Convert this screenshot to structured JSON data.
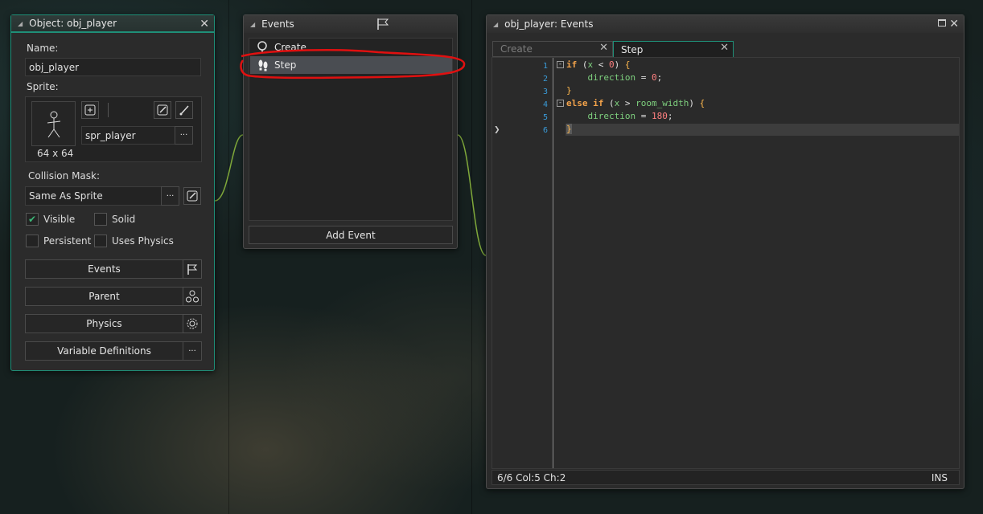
{
  "object_panel": {
    "title": "Object: obj_player",
    "name_label": "Name:",
    "name_value": "obj_player",
    "sprite_label": "Sprite:",
    "sprite_size": "64 x 64",
    "sprite_name": "spr_player",
    "more_glyph": "···",
    "collision_label": "Collision Mask:",
    "collision_value": "Same As Sprite",
    "visible_label": "Visible",
    "solid_label": "Solid",
    "persistent_label": "Persistent",
    "uses_physics_label": "Uses Physics",
    "visible_checked": true,
    "buttons": {
      "events": "Events",
      "parent": "Parent",
      "physics": "Physics",
      "variable_definitions": "Variable Definitions"
    }
  },
  "events_panel": {
    "title": "Events",
    "items": [
      "Create",
      "Step"
    ],
    "selected": "Step",
    "add_event": "Add Event"
  },
  "code_panel": {
    "title": "obj_player: Events",
    "tabs": [
      {
        "label": "Create",
        "active": false
      },
      {
        "label": "Step",
        "active": true
      }
    ],
    "line_numbers": [
      "1",
      "2",
      "3",
      "4",
      "5",
      "6"
    ],
    "code": {
      "l1_kw": "if",
      "l1_a": "(",
      "l1_var": "x",
      "l1_b": " < ",
      "l1_num": "0",
      "l1_c": ") ",
      "l1_br": "{",
      "l2_var": "direction",
      "l2_op": " = ",
      "l2_num": "0",
      "l2_end": ";",
      "l3_br": "}",
      "l4_kw1": "else",
      "l4_kw2": "if",
      "l4_a": "(",
      "l4_var1": "x",
      "l4_b": " > ",
      "l4_var2": "room_width",
      "l4_c": ") ",
      "l4_br": "{",
      "l5_var": "direction",
      "l5_op": " = ",
      "l5_num": "180",
      "l5_end": ";",
      "l6_br": "}"
    },
    "status_position": "6/6 Col:5 Ch:2",
    "status_mode": "INS"
  },
  "colors": {
    "accent_teal": "#1f8f78",
    "annotation_red": "#e01010",
    "line_number_blue": "#3a9bd8"
  }
}
